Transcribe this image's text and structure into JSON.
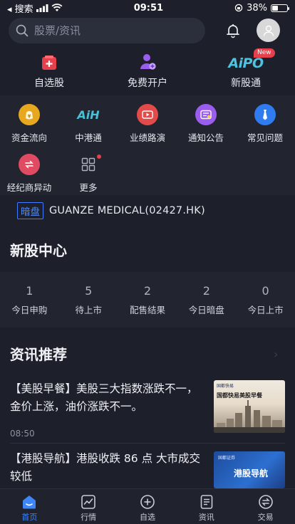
{
  "status_bar": {
    "back_label": "◂ 搜索",
    "time": "09:51",
    "battery": "38%",
    "battery_level": 0.38
  },
  "search": {
    "placeholder": "股票/资讯"
  },
  "top_actions": [
    {
      "label": "自选股",
      "icon": "watchlist-icon"
    },
    {
      "label": "免费开户",
      "icon": "open-account-icon"
    },
    {
      "label": "新股通",
      "icon": "aipo-icon",
      "badge": "New",
      "logo_text": "AiPO"
    }
  ],
  "grid_menu": [
    {
      "label": "资金流向",
      "icon": "money-bag-icon",
      "color": "#e7a81f"
    },
    {
      "label": "中港通",
      "icon": "aih-icon",
      "logo_text": "AiH",
      "color": "#4ac0d8"
    },
    {
      "label": "业绩路演",
      "icon": "video-icon",
      "color": "#e34b4b"
    },
    {
      "label": "通知公告",
      "icon": "notice-icon",
      "color": "#9b5cf0"
    },
    {
      "label": "常见问题",
      "icon": "faq-icon",
      "color": "#2f7cf0"
    },
    {
      "label": "经纪商异动",
      "icon": "broker-icon",
      "color": "#e04a62"
    },
    {
      "label": "更多",
      "icon": "more-grid-icon",
      "color": "#aeb3c2"
    }
  ],
  "dark_pool": {
    "tag": "暗盘",
    "text": "GUANZE MEDICAL(02427.HK)"
  },
  "ipo_center": {
    "title": "新股中心",
    "stats": [
      {
        "value": "1",
        "label": "今日申购"
      },
      {
        "value": "5",
        "label": "待上市"
      },
      {
        "value": "2",
        "label": "配售结果"
      },
      {
        "value": "2",
        "label": "今日暗盘"
      },
      {
        "value": "0",
        "label": "今日上市"
      }
    ]
  },
  "news_section": {
    "title": "资讯推荐",
    "items": [
      {
        "title": "【美股早餐】美股三大指数涨跌不一，金价上涨，油价涨跌不一。",
        "time": "08:50",
        "thumb_brand": "国都快易",
        "thumb_title": "国都快易美股早餐"
      },
      {
        "title": "【港股导航】港股收跌 86 点 大市成交较低",
        "time": "",
        "thumb_brand": "国都证券",
        "thumb_title": "港股导航"
      }
    ]
  },
  "tab_bar": [
    {
      "label": "首页",
      "icon": "home-icon",
      "active": true
    },
    {
      "label": "行情",
      "icon": "market-chart-icon",
      "active": false
    },
    {
      "label": "自选",
      "icon": "add-watch-icon",
      "active": false
    },
    {
      "label": "资讯",
      "icon": "news-doc-icon",
      "active": false
    },
    {
      "label": "交易",
      "icon": "trade-icon",
      "active": false
    }
  ]
}
